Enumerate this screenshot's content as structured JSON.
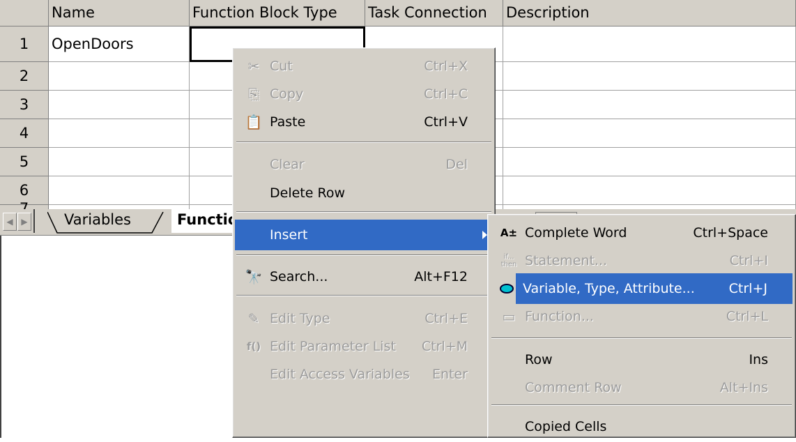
{
  "grid": {
    "columns": [
      "Name",
      "Function Block Type",
      "Task Connection",
      "Description"
    ],
    "row_numbers": [
      "1",
      "2",
      "3",
      "4",
      "5",
      "6",
      "7"
    ],
    "rows": [
      [
        "OpenDoors",
        "",
        "",
        ""
      ],
      [
        "",
        "",
        "",
        ""
      ],
      [
        "",
        "",
        "",
        ""
      ],
      [
        "",
        "",
        "",
        ""
      ],
      [
        "",
        "",
        "",
        ""
      ],
      [
        "",
        "",
        "",
        ""
      ],
      [
        "",
        "",
        "",
        ""
      ]
    ]
  },
  "tabs": {
    "items": [
      "Variables",
      "Functio"
    ],
    "active": "Functio"
  },
  "context_menu": {
    "items": [
      {
        "label": "Cut",
        "shortcut": "Ctrl+X",
        "icon": "scissors-icon",
        "enabled": false
      },
      {
        "label": "Copy",
        "shortcut": "Ctrl+C",
        "icon": "copy-icon",
        "enabled": false
      },
      {
        "label": "Paste",
        "shortcut": "Ctrl+V",
        "icon": "paste-icon",
        "enabled": true
      },
      {
        "label": "Clear",
        "shortcut": "Del",
        "enabled": false
      },
      {
        "label": "Delete Row",
        "shortcut": "",
        "enabled": true
      },
      {
        "label": "Insert",
        "shortcut": "",
        "enabled": true,
        "highlighted": true,
        "has_submenu": true
      },
      {
        "label": "Search...",
        "shortcut": "Alt+F12",
        "icon": "search-binoculars-icon",
        "enabled": true
      },
      {
        "label": "Edit Type",
        "shortcut": "Ctrl+E",
        "icon": "edit-type-icon",
        "enabled": false
      },
      {
        "label": "Edit Parameter List",
        "shortcut": "Ctrl+M",
        "icon": "function-params-icon",
        "enabled": false
      },
      {
        "label": "Edit Access Variables",
        "shortcut": "Enter",
        "enabled": false
      }
    ]
  },
  "insert_submenu": {
    "items": [
      {
        "label": "Complete Word",
        "shortcut": "Ctrl+Space",
        "icon": "complete-word-icon",
        "enabled": true
      },
      {
        "label": "Statement...",
        "shortcut": "Ctrl+I",
        "icon": "if-then-icon",
        "enabled": false
      },
      {
        "label": "Variable, Type, Attribute...",
        "shortcut": "Ctrl+J",
        "icon": "variable-ellipse-icon",
        "enabled": true,
        "highlighted": true
      },
      {
        "label": "Function...",
        "shortcut": "Ctrl+L",
        "icon": "function-icon",
        "enabled": false
      },
      {
        "label": "Row",
        "shortcut": "Ins",
        "enabled": true
      },
      {
        "label": "Comment Row",
        "shortcut": "Alt+Ins",
        "enabled": false
      },
      {
        "label": "Copied Cells",
        "shortcut": "",
        "enabled": true
      }
    ]
  },
  "icon_glyphs": {
    "scissors": "✂",
    "copy": "⎘",
    "paste": "📋",
    "search": "🔭",
    "edit_type": "✎",
    "function_params": "f()",
    "complete_word": "A±",
    "if_then_top": "if...",
    "if_then_bottom": "then",
    "variable": "⬭",
    "function": "▭"
  },
  "colors": {
    "menu_bg": "#d4d0c8",
    "highlight": "#316ac5",
    "disabled_text": "#9c9c9c"
  }
}
